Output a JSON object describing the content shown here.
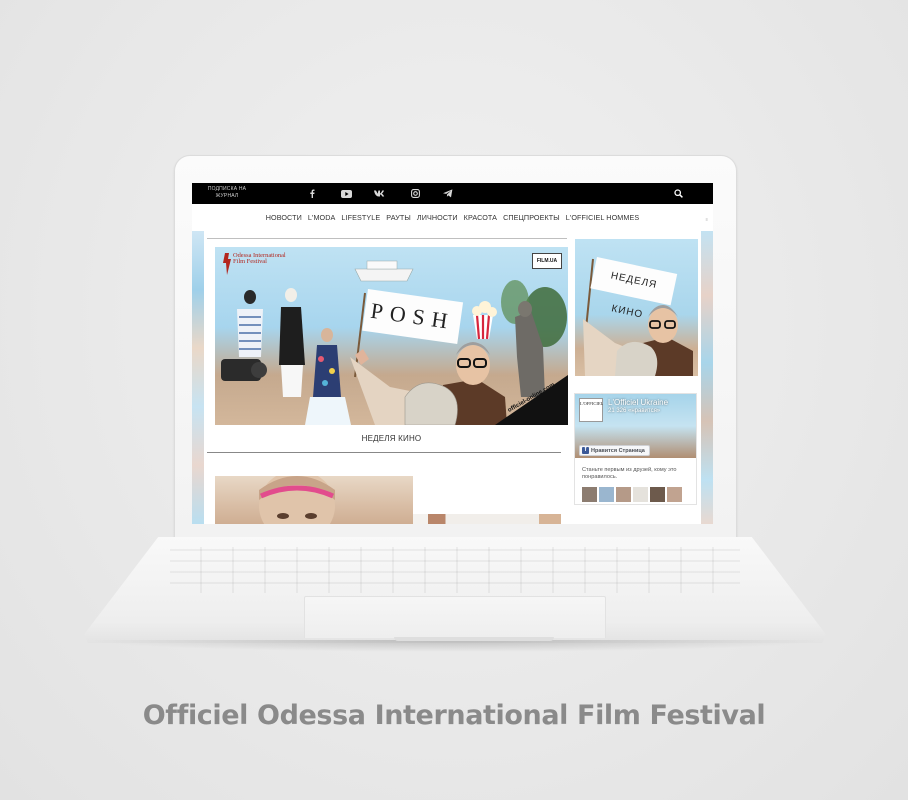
{
  "caption": "Officiel Odessa International Film Festival",
  "site": {
    "subscribe_label": "ПОДПИСКА НА ЖУРНАЛ",
    "social_icons": [
      "facebook-icon",
      "youtube-icon",
      "vk-icon",
      "instagram-icon",
      "telegram-icon"
    ],
    "search_icon": "search-icon",
    "nav": [
      "НОВОСТИ",
      "L'MODA",
      "LIFESTYLE",
      "РАУТЫ",
      "ЛИЧНОСТИ",
      "КРАСОТА",
      "СПЕЦПРОЕКТЫ",
      "L'OFFICIEL HOMMES"
    ]
  },
  "hero": {
    "festival_logo_text": "Odessa International Film Festival",
    "partner_logo": "FILM.UA",
    "flag_text": "POSH",
    "watermark": "officiel-online.com",
    "caption": "НЕДЕЛЯ КИНО"
  },
  "sidebar": {
    "poster_flag_text": "НЕДЕЛЯ КИНО",
    "facebook": {
      "logo_text": "L'OFFICIEL",
      "page_name": "L'Officiel Ukraine",
      "likes": "21 326 «нравится»",
      "like_button": "Нравится Страница",
      "friends_text": "Станьте первым из друзей, кому это понравилось."
    }
  },
  "colors": {
    "topbar": "#000000",
    "caption": "#8a8a8a",
    "facebook_blue": "#3b5998",
    "festival_red": "#b3261e"
  }
}
